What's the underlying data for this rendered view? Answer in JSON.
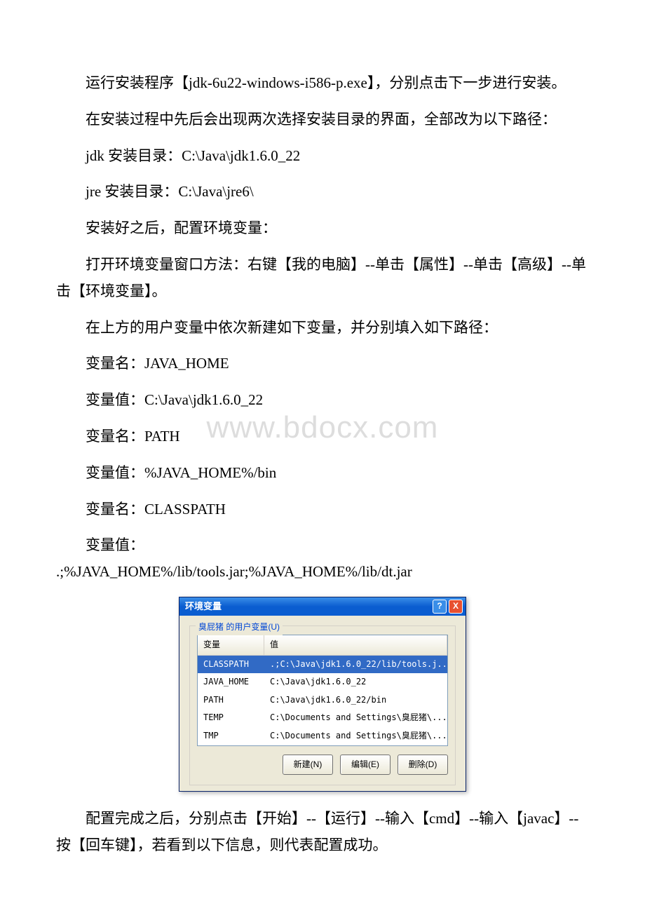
{
  "watermark": "www.bdocx.com",
  "paragraphs": {
    "p1": "运行安装程序【jdk-6u22-windows-i586-p.exe】，分别点击下一步进行安装。",
    "p2": "在安装过程中先后会出现两次选择安装目录的界面，全部改为以下路径：",
    "p3": "jdk 安装目录：C:\\Java\\jdk1.6.0_22",
    "p4": "jre 安装目录：C:\\Java\\jre6\\",
    "p5": "安装好之后，配置环境变量：",
    "p6": "打开环境变量窗口方法：右键【我的电脑】--单击【属性】--单击【高级】--单击【环境变量】。",
    "p7": "在上方的用户变量中依次新建如下变量，并分别填入如下路径：",
    "p8": "变量名：JAVA_HOME",
    "p9": "变量值：C:\\Java\\jdk1.6.0_22",
    "p10": "变量名：PATH",
    "p11": "变量值：%JAVA_HOME%/bin",
    "p12": "变量名：CLASSPATH",
    "p13a": "变量值：",
    "p13b": ".;%JAVA_HOME%/lib/tools.jar;%JAVA_HOME%/lib/dt.jar",
    "p14": "配置完成之后，分别点击【开始】--【运行】--输入【cmd】--输入【javac】--按【回车键】，若看到以下信息，则代表配置成功。"
  },
  "dialog": {
    "title": "环境变量",
    "help_glyph": "?",
    "close_glyph": "X",
    "group_label": "臭屁猪 的用户变量(U)",
    "columns": {
      "name": "变量",
      "value": "值"
    },
    "rows": [
      {
        "name": "CLASSPATH",
        "value": ".;C:\\Java\\jdk1.6.0_22/lib/tools.j...",
        "selected": true
      },
      {
        "name": "JAVA_HOME",
        "value": "C:\\Java\\jdk1.6.0_22",
        "selected": false
      },
      {
        "name": "PATH",
        "value": "C:\\Java\\jdk1.6.0_22/bin",
        "selected": false
      },
      {
        "name": "TEMP",
        "value": "C:\\Documents and Settings\\臭屁猪\\...",
        "selected": false
      },
      {
        "name": "TMP",
        "value": "C:\\Documents and Settings\\臭屁猪\\...",
        "selected": false
      }
    ],
    "buttons": {
      "new": "新建(N)",
      "edit": "编辑(E)",
      "delete": "删除(D)"
    }
  }
}
